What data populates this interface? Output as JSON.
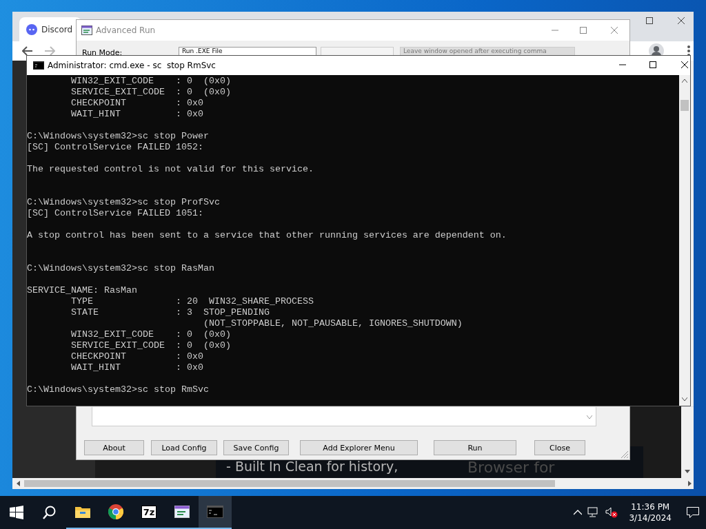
{
  "browser_window": {
    "tab_title": "Discord",
    "page_texts": [
      "- Built In Clean for history,",
      "Browser for"
    ]
  },
  "advanced_run": {
    "title": "Advanced Run",
    "run_mode_label": "Run Mode:",
    "run_mode_value": "Run .EXE File",
    "option_text": "Leave window opened after executing comma",
    "buttons": [
      "About",
      "Load Config",
      "Save Config",
      "Add Explorer Menu",
      "Run",
      "Close"
    ]
  },
  "console": {
    "title": "Administrator: cmd.exe - sc  stop RmSvc",
    "lines": [
      {
        "kind": "text",
        "text": "        WIN32_EXIT_CODE    : 0  (0x0)"
      },
      {
        "kind": "text",
        "text": "        SERVICE_EXIT_CODE  : 0  (0x0)"
      },
      {
        "kind": "text",
        "text": "        CHECKPOINT         : 0x0"
      },
      {
        "kind": "text",
        "text": "        WAIT_HINT          : 0x0"
      },
      {
        "kind": "blank"
      },
      {
        "kind": "text",
        "text": "C:\\Windows\\system32>sc stop Power"
      },
      {
        "kind": "text",
        "text": "[SC] ControlService FAILED 1052:"
      },
      {
        "kind": "blank"
      },
      {
        "kind": "text",
        "text": "The requested control is not valid for this service."
      },
      {
        "kind": "blank"
      },
      {
        "kind": "blank"
      },
      {
        "kind": "text",
        "text": "C:\\Windows\\system32>sc stop ProfSvc"
      },
      {
        "kind": "text",
        "text": "[SC] ControlService FAILED 1051:"
      },
      {
        "kind": "blank"
      },
      {
        "kind": "text",
        "text": "A stop control has been sent to a service that other running services are dependent on."
      },
      {
        "kind": "blank"
      },
      {
        "kind": "blank"
      },
      {
        "kind": "text",
        "text": "C:\\Windows\\system32>sc stop RasMan"
      },
      {
        "kind": "blank"
      },
      {
        "kind": "text",
        "text": "SERVICE_NAME: RasMan"
      },
      {
        "kind": "text",
        "text": "        TYPE               : 20  WIN32_SHARE_PROCESS"
      },
      {
        "kind": "text",
        "text": "        STATE              : 3  STOP_PENDING"
      },
      {
        "kind": "text",
        "text": "                                (NOT_STOPPABLE, NOT_PAUSABLE, IGNORES_SHUTDOWN)"
      },
      {
        "kind": "text",
        "text": "        WIN32_EXIT_CODE    : 0  (0x0)"
      },
      {
        "kind": "text",
        "text": "        SERVICE_EXIT_CODE  : 0  (0x0)"
      },
      {
        "kind": "text",
        "text": "        CHECKPOINT         : 0x0"
      },
      {
        "kind": "text",
        "text": "        WAIT_HINT          : 0x0"
      },
      {
        "kind": "blank"
      },
      {
        "kind": "text",
        "text": "C:\\Windows\\system32>sc stop RmSvc"
      }
    ]
  },
  "taskbar": {
    "apps": [
      {
        "kind": "folder",
        "selected": false
      },
      {
        "kind": "chrome",
        "selected": false
      },
      {
        "kind": "archiver",
        "label": "7z",
        "selected": false
      },
      {
        "kind": "runner",
        "selected": false
      },
      {
        "kind": "terminal",
        "selected": true
      }
    ],
    "clock": {
      "time": "11:36 PM",
      "date": "3/14/2024"
    }
  }
}
